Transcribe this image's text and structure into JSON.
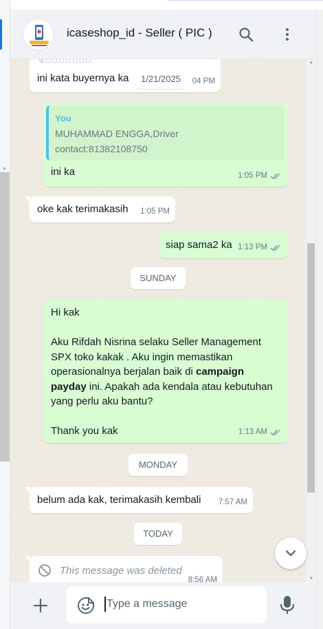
{
  "header": {
    "title": "icaseshop_id - Seller ( PIC )",
    "icons": [
      "avatar-logo",
      "search-icon",
      "menu-dots-icon"
    ]
  },
  "floating_date": "1/21/2025",
  "messages": [
    {
      "id": "m1",
      "direction": "in",
      "text": "ini kata buyernya ka",
      "time": "1:04 PM",
      "time_visible": "04 PM"
    },
    {
      "id": "m2",
      "direction": "out",
      "quote": {
        "author": "You",
        "line1": "MUHAMMAD ENGGA,Driver",
        "line2": "contact:81382108750"
      },
      "text": "ini ka",
      "time": "1:05 PM",
      "status": "read"
    },
    {
      "id": "m3",
      "direction": "in",
      "text": "oke kak terimakasih",
      "time": "1:05 PM"
    },
    {
      "id": "m4",
      "direction": "out",
      "text": "siap sama2 ka",
      "time": "1:13 PM",
      "status": "read"
    },
    {
      "id": "m5",
      "direction": "out",
      "greeting": "Hi kak",
      "body_a": "Aku Rifdah Nisrina selaku Seller Management SPX toko kakak . Aku ingin memastikan operasionalnya berjalan baik di ",
      "body_bold": "campaign payday",
      "body_b": " ini. Apakah ada kendala atau kebutuhan yang perlu aku bantu?",
      "closing": "Thank you kak",
      "time": "1:13 AM",
      "status": "read"
    },
    {
      "id": "m6",
      "direction": "in",
      "text": "belum ada kak, terimakasih kembali",
      "time": "7:57 AM"
    },
    {
      "id": "m7",
      "direction": "in",
      "deleted": true,
      "text": "This message was deleted",
      "time": "8:56 AM"
    }
  ],
  "date_separators": [
    "SUNDAY",
    "MONDAY",
    "TODAY"
  ],
  "composer": {
    "placeholder": "Type a message",
    "icons": [
      "plus-icon",
      "emoji-icon",
      "mic-icon"
    ]
  },
  "colors": {
    "incoming_bubble": "#ffffff",
    "outgoing_bubble": "#d9fdd3",
    "chat_background": "#efeae2",
    "read_tick": "#8696a0",
    "quote_bar": "#53bdeb"
  }
}
